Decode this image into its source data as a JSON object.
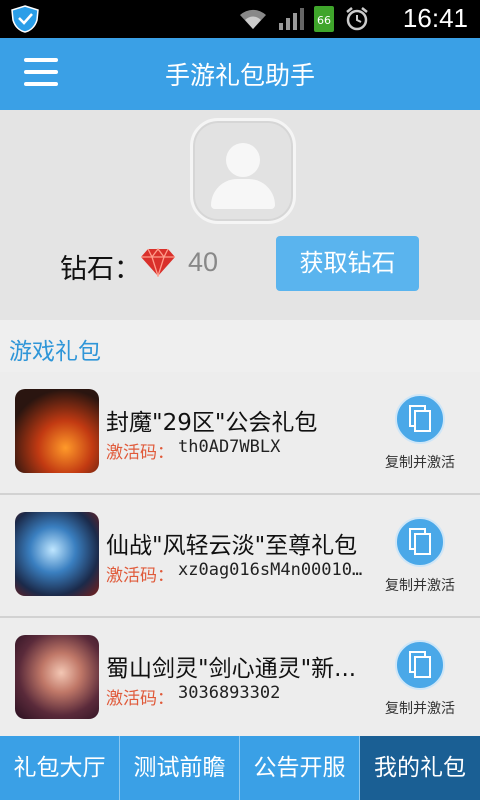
{
  "status": {
    "time": "16:41",
    "battery": "66"
  },
  "header": {
    "title": "手游礼包助手"
  },
  "profile": {
    "diamond_label": "钻石：",
    "diamond_count": "40",
    "get_button": "获取钻石"
  },
  "section": {
    "title": "游戏礼包"
  },
  "gifts": [
    {
      "name": "封魔\"29区\"公会礼包",
      "code_label": "激活码：",
      "code": "th0AD7WBLX",
      "action": "复制并激活"
    },
    {
      "name": "仙战\"风轻云淡\"至尊礼包",
      "code_label": "激活码：",
      "code": "xz0ag016sM4n00010...",
      "action": "复制并激活"
    },
    {
      "name": "蜀山剑灵\"剑心通灵\"新...",
      "code_label": "激活码：",
      "code": "3036893302",
      "action": "复制并激活"
    }
  ],
  "tabs": [
    "礼包大厅",
    "测试前瞻",
    "公告开服",
    "我的礼包"
  ],
  "active_tab": 3,
  "colors": {
    "primary": "#3aa0e6",
    "active_tab": "#1a5f94",
    "code_label": "#e05a3a",
    "section_title": "#2f96d8"
  }
}
